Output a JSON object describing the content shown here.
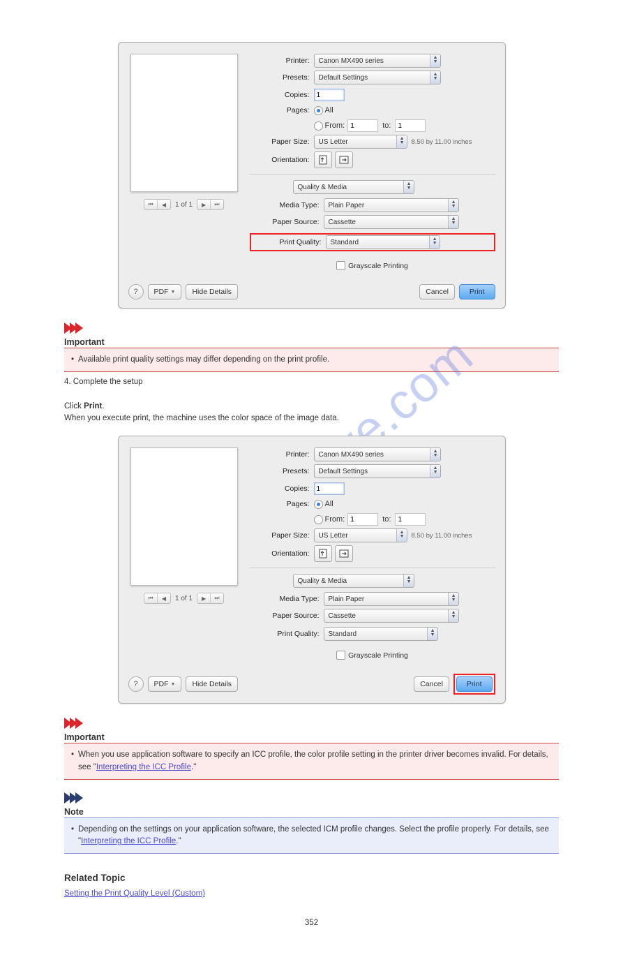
{
  "watermark": "manualshive.com",
  "dialog": {
    "printer_label": "Printer:",
    "printer_value": "Canon MX490 series",
    "presets_label": "Presets:",
    "presets_value": "Default Settings",
    "copies_label": "Copies:",
    "copies_value": "1",
    "pages_label": "Pages:",
    "pages_all": "All",
    "pages_from": "From:",
    "pages_from_value": "1",
    "pages_to": "to:",
    "pages_to_value": "1",
    "papersize_label": "Paper Size:",
    "papersize_value": "US Letter",
    "papersize_dim": "8.50 by 11.00 inches",
    "orientation_label": "Orientation:",
    "section_value": "Quality & Media",
    "mediatype_label": "Media Type:",
    "mediatype_value": "Plain Paper",
    "papersource_label": "Paper Source:",
    "papersource_value": "Cassette",
    "printquality_label": "Print Quality:",
    "printquality_value": "Standard",
    "grayscale_label": "Grayscale Printing",
    "nav_text": "1 of 1",
    "pdf_label": "PDF",
    "hide_label": "Hide Details",
    "cancel_label": "Cancel",
    "print_label": "Print"
  },
  "text": {
    "important1_title": "Important",
    "important1_body": "Available print quality settings may differ depending on the print profile.",
    "step4_num": "4.",
    "step4_body": "Complete the setup",
    "step4_detail_a": "Click ",
    "step4_detail_b": "Print",
    "step4_detail_c": ".",
    "step4_detail_d": "When you execute print, the machine uses the color space of the image data.",
    "important2_title": "Important",
    "important2_body_a": "When you use application software to specify an ICC profile, the color profile setting in the printer driver becomes invalid. For details, see \"",
    "important2_link": "Interpreting the ICC Profile",
    "important2_body_b": ".\"",
    "note_title": "Note",
    "note_bullet1_a": "Depending on the settings on your application software, the selected ICM profile changes. Select the profile properly. For details, see \"",
    "note_bullet1_link": "Interpreting the ICC Profile",
    "note_bullet1_b": ".\"",
    "related_title": "Related Topic",
    "related_link": "Setting the Print Quality Level (Custom)",
    "page_number": "352"
  }
}
